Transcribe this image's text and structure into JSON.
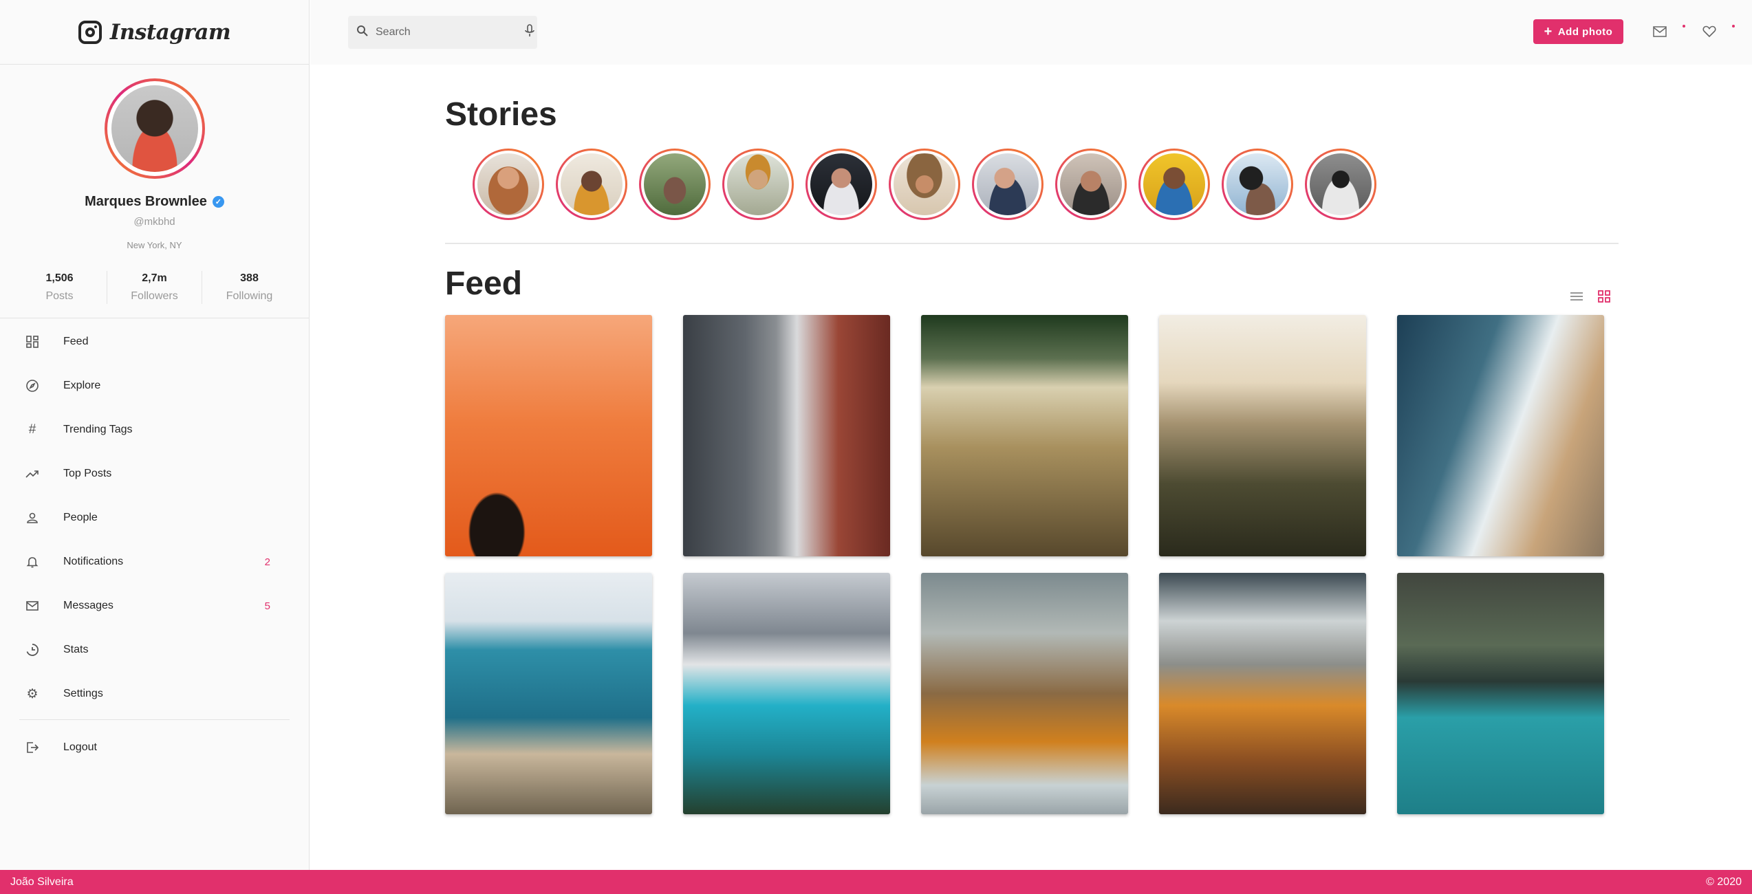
{
  "app": {
    "logo_text": "Instagram"
  },
  "search": {
    "placeholder": "Search"
  },
  "header": {
    "add_photo_label": "Add photo"
  },
  "profile": {
    "name": "Marques Brownlee",
    "handle": "@mkbhd",
    "location": "New York, NY",
    "stats": [
      {
        "value": "1,506",
        "label": "Posts"
      },
      {
        "value": "2,7m",
        "label": "Followers"
      },
      {
        "value": "388",
        "label": "Following"
      }
    ]
  },
  "nav": {
    "items": [
      {
        "label": "Feed",
        "icon": "grid-icon"
      },
      {
        "label": "Explore",
        "icon": "compass-icon"
      },
      {
        "label": "Trending Tags",
        "icon": "hashtag-icon"
      },
      {
        "label": "Top Posts",
        "icon": "trending-icon"
      },
      {
        "label": "People",
        "icon": "person-icon"
      },
      {
        "label": "Notifications",
        "icon": "bell-icon",
        "count": "2"
      },
      {
        "label": "Messages",
        "icon": "mail-icon",
        "count": "5"
      },
      {
        "label": "Stats",
        "icon": "pie-chart-icon"
      },
      {
        "label": "Settings",
        "icon": "gear-icon"
      }
    ],
    "logout_label": "Logout"
  },
  "main": {
    "stories_title": "Stories",
    "feed_title": "Feed",
    "story_count": 11,
    "feed_view": "grid"
  },
  "colors": {
    "accent": "#e1306c",
    "story_gradient_start": "#dd2a7b",
    "story_gradient_end": "#f58529"
  },
  "footer": {
    "author": "João Silveira",
    "copyright": "© 2020"
  }
}
